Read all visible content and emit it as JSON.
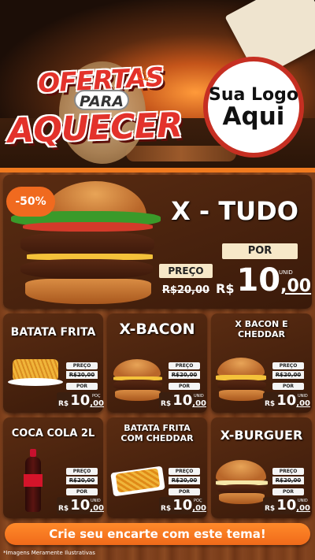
{
  "header": {
    "title_line1": "OFERTAS",
    "title_line2": "PARA",
    "title_line3": "AQUECER",
    "logo_line1": "Sua Logo",
    "logo_line2": "Aqui"
  },
  "featured": {
    "discount": "-50%",
    "name": "X - TUDO",
    "preco_label": "PREÇO",
    "old_price": "R$20,00",
    "por_label": "POR",
    "currency": "R$",
    "price_int": "10",
    "price_dec": ",00",
    "unit": "UNID"
  },
  "products": [
    {
      "name": "BATATA FRITA",
      "preco_label": "PREÇO",
      "old_price": "R$20,00",
      "por_label": "POR",
      "currency": "R$",
      "price_int": "10",
      "price_dec": ",00",
      "unit": "POÇ"
    },
    {
      "name": "X-BACON",
      "preco_label": "PREÇO",
      "old_price": "R$20,00",
      "por_label": "POR",
      "currency": "R$",
      "price_int": "10",
      "price_dec": ",00",
      "unit": "UNID"
    },
    {
      "name": "X BACON E CHEDDAR",
      "preco_label": "PREÇO",
      "old_price": "R$20,00",
      "por_label": "POR",
      "currency": "R$",
      "price_int": "10",
      "price_dec": ",00",
      "unit": "UNID"
    },
    {
      "name": "COCA COLA 2L",
      "preco_label": "PREÇO",
      "old_price": "R$20,00",
      "por_label": "POR",
      "currency": "R$",
      "price_int": "10",
      "price_dec": ",00",
      "unit": "UNID"
    },
    {
      "name": "BATATA FRITA COM CHEDDAR",
      "preco_label": "PREÇO",
      "old_price": "R$20,00",
      "por_label": "POR",
      "currency": "R$",
      "price_int": "10",
      "price_dec": ",00",
      "unit": "POÇ"
    },
    {
      "name": "X-BURGUER",
      "preco_label": "PREÇO",
      "old_price": "R$20,00",
      "por_label": "POR",
      "currency": "R$",
      "price_int": "10",
      "price_dec": ",00",
      "unit": "UNID"
    }
  ],
  "cta": "Crie seu encarte com este tema!",
  "footnote": "*Imagens Meramente Ilustrativas",
  "colors": {
    "accent": "#f06a1f",
    "title_red": "#e3322b",
    "wood": "#7a3d1a"
  }
}
